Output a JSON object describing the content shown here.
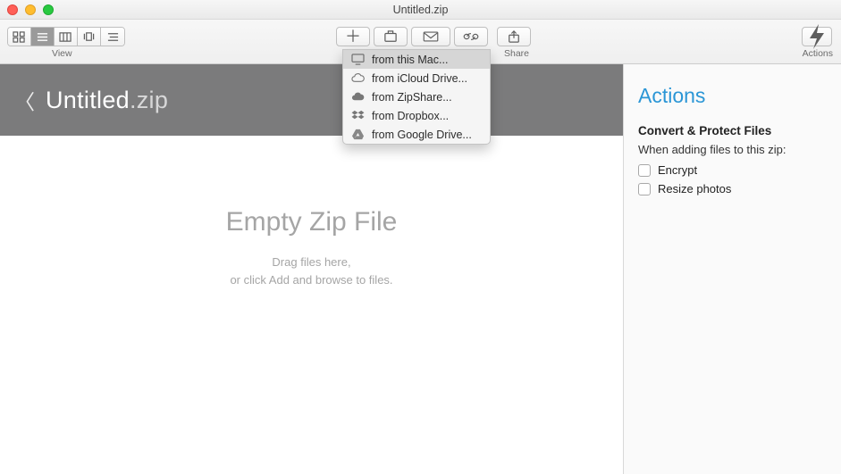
{
  "titlebar": {
    "title": "Untitled.zip"
  },
  "toolbar": {
    "view_label": "View",
    "share_label": "Share",
    "actions_label": "Actions"
  },
  "add_menu": {
    "items": [
      {
        "label": "from this Mac...",
        "icon": "monitor"
      },
      {
        "label": "from iCloud Drive...",
        "icon": "cloud-outline"
      },
      {
        "label": "from ZipShare...",
        "icon": "cloud-solid"
      },
      {
        "label": "from Dropbox...",
        "icon": "dropbox"
      },
      {
        "label": "from Google Drive...",
        "icon": "gdrive"
      }
    ]
  },
  "header": {
    "filename": "Untitled",
    "ext": ".zip"
  },
  "empty_state": {
    "title": "Empty Zip File",
    "line1": "Drag files here,",
    "line2": "or click Add and browse to files."
  },
  "sidebar": {
    "title": "Actions",
    "section": "Convert & Protect Files",
    "subtitle": "When adding files to this zip:",
    "options": [
      {
        "label": "Encrypt",
        "checked": false
      },
      {
        "label": "Resize photos",
        "checked": false
      }
    ]
  }
}
